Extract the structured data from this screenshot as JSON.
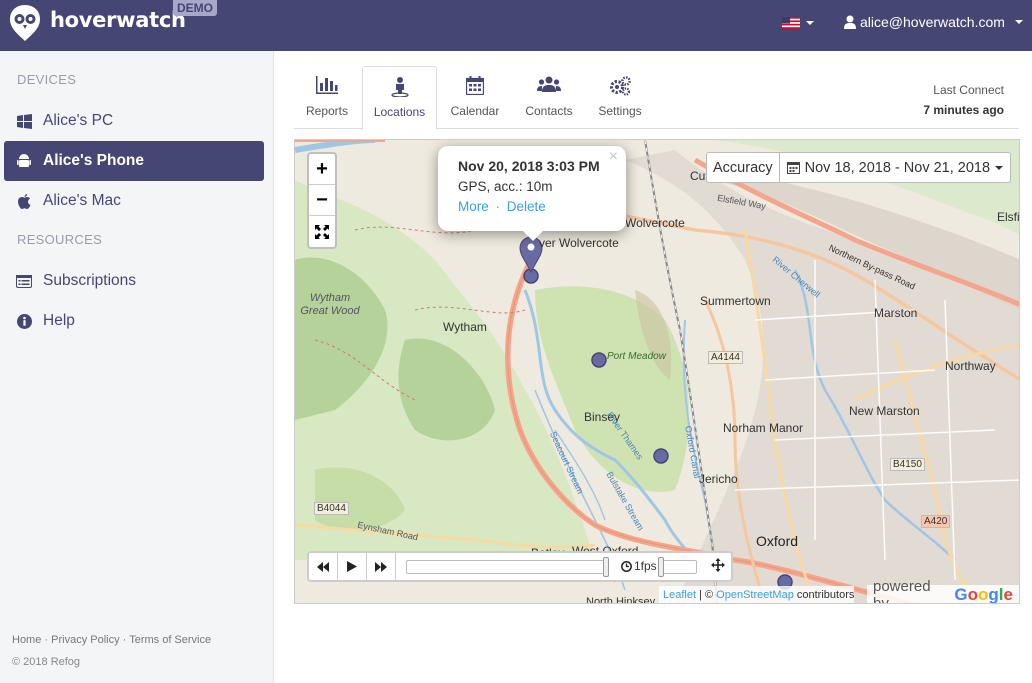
{
  "header": {
    "brand": "hoverwatch",
    "badge": "DEMO",
    "user_email": "alice@hoverwatch.com",
    "flag_icon": "us-flag-icon",
    "logo_icon": "owl-logo-icon",
    "bg_color": "#464675"
  },
  "sidebar": {
    "devices_heading": "DEVICES",
    "devices": [
      {
        "label": "Alice's PC",
        "icon": "windows-icon"
      },
      {
        "label": "Alice's Phone",
        "icon": "android-icon",
        "active": true
      },
      {
        "label": "Alice's Mac",
        "icon": "apple-icon"
      }
    ],
    "resources_heading": "RESOURCES",
    "resources": [
      {
        "label": "Subscriptions",
        "icon": "list-icon"
      },
      {
        "label": "Help",
        "icon": "info-icon"
      }
    ],
    "footer_links": [
      "Home",
      "Privacy Policy",
      "Terms of Service"
    ],
    "footer_separator": "·",
    "copyright": "© 2018 Refog"
  },
  "tabs": [
    {
      "label": "Reports",
      "icon": "bar-chart-icon"
    },
    {
      "label": "Locations",
      "icon": "person-pin-icon",
      "active": true
    },
    {
      "label": "Calendar",
      "icon": "calendar-icon"
    },
    {
      "label": "Contacts",
      "icon": "people-icon"
    },
    {
      "label": "Settings",
      "icon": "gears-icon"
    }
  ],
  "last_connect": {
    "label": "Last Connect",
    "value": "7 minutes ago"
  },
  "map": {
    "zoom_in": "+",
    "zoom_out": "−",
    "popup": {
      "title": "Nov 20, 2018 3:03 PM",
      "subtitle": "GPS, acc.: 10m",
      "more": "More",
      "delete": "Delete",
      "separator": "·",
      "close": "×"
    },
    "filter": {
      "accuracy": "Accuracy",
      "date_range": "Nov 18, 2018 - Nov 21, 2018"
    },
    "player": {
      "fps": "1fps"
    },
    "attribution": {
      "leaflet": "Leaflet",
      "sep": " | © ",
      "osm": "OpenStreetMap",
      "contrib": " contributors"
    },
    "powered_by": "powered by",
    "google": "Google",
    "places": [
      {
        "name": "Wolvercote",
        "key": "wolvercote"
      },
      {
        "name": "ver Wolvercote",
        "key": "lower-wolvercote"
      },
      {
        "name": "Cut",
        "key": "cutteslowe"
      },
      {
        "name": "Elsfield Way",
        "key": "elsfield-way"
      },
      {
        "name": "Elsfie",
        "key": "elsfield"
      },
      {
        "name": "Northern By-pass Road",
        "key": "northern-bypass"
      },
      {
        "name": "Summertown",
        "key": "summertown"
      },
      {
        "name": "River Cherwell",
        "key": "river-cherwell"
      },
      {
        "name": "Marston",
        "key": "marston"
      },
      {
        "name": "Wytham",
        "key": "wytham"
      },
      {
        "name": "Wytham Great Wood",
        "key": "wytham-great-wood"
      },
      {
        "name": "Port Meadow",
        "key": "port-meadow"
      },
      {
        "name": "A4144",
        "key": "a4144"
      },
      {
        "name": "Northway",
        "key": "northway"
      },
      {
        "name": "New Marston",
        "key": "new-marston"
      },
      {
        "name": "Binsey",
        "key": "binsey"
      },
      {
        "name": "River Thames",
        "key": "river-thames"
      },
      {
        "name": "Oxford Canal",
        "key": "oxford-canal"
      },
      {
        "name": "Norham Manor",
        "key": "norham-manor"
      },
      {
        "name": "Seacourt Stream",
        "key": "seacourt-stream"
      },
      {
        "name": "Bulstake Stream",
        "key": "bulstake-stream"
      },
      {
        "name": "Jericho",
        "key": "jericho"
      },
      {
        "name": "B4150",
        "key": "b4150"
      },
      {
        "name": "B4044",
        "key": "b4044"
      },
      {
        "name": "Eynsham Road",
        "key": "eynsham-road"
      },
      {
        "name": "A420",
        "key": "a420"
      },
      {
        "name": "Oxford",
        "key": "oxford"
      },
      {
        "name": "Botley",
        "key": "botley"
      },
      {
        "name": "West Oxford",
        "key": "west-oxford"
      },
      {
        "name": "North Hinksey",
        "key": "north-hinksey"
      }
    ]
  }
}
